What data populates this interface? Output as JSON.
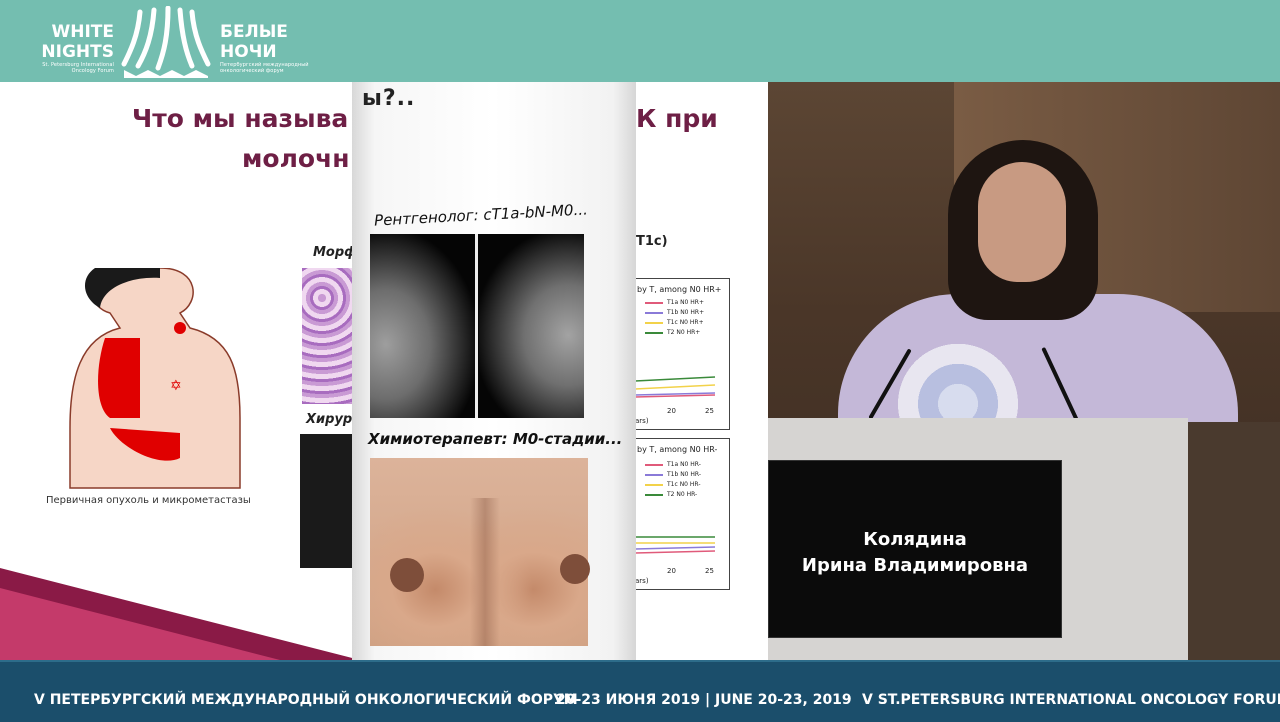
{
  "header": {
    "logo_en_line1": "WHITE",
    "logo_en_line2": "NIGHTS",
    "logo_en_sub": "St. Petersburg International Oncology Forum",
    "logo_ru_line1": "БЕЛЫЕ",
    "logo_ru_line2": "НОЧИ",
    "logo_ru_sub": "Петербургский международный онкологический форум",
    "colors": {
      "banner": "#74beb0",
      "logo": "#ffffff"
    }
  },
  "slide": {
    "title_line1": "Что мы называ",
    "title_line1_end": "К при",
    "title_line2": "молочн",
    "diagram_caption": "Первичная опухоль и микрометастазы",
    "morph_label": "Морф",
    "surg_label": "Хирург",
    "chart_section_label": "T1c)",
    "colors": {
      "title": "#6e1f45"
    }
  },
  "popup": {
    "header": "ы?..",
    "radiologist_label": "Рентгенолог: cT1a-bN-M0...",
    "chemo_label": "Химиотерапевт: M0-стадии..."
  },
  "charts": [
    {
      "title": "by T, among N0 HR+",
      "legend": [
        "T1a N0 HR+",
        "T1b N0 HR+",
        "T1c N0 HR+",
        "T2 N0 HR+"
      ],
      "colors": [
        "#e05a7a",
        "#8a7ad8",
        "#f2d24a",
        "#3a8a3a"
      ],
      "ticks": [
        "20",
        "25"
      ],
      "xlabel": "ars)"
    },
    {
      "title": "by T, among N0 HR-",
      "legend": [
        "T1a N0 HR-",
        "T1b N0 HR-",
        "T1c N0 HR-",
        "T2 N0 HR-"
      ],
      "colors": [
        "#e05a7a",
        "#8a7ad8",
        "#f2d24a",
        "#3a8a3a"
      ],
      "ticks": [
        "20",
        "25"
      ],
      "xlabel": "ars)"
    }
  ],
  "speaker": {
    "name_line1": "Колядина",
    "name_line2": "Ирина Владимировна"
  },
  "footer": {
    "left": "V ПЕТЕРБУРГСКИЙ МЕЖДУНАРОДНЫЙ ОНКОЛОГИЧЕСКИЙ ФОРУМ",
    "middle": "20-23 ИЮНЯ 2019 | JUNE 20-23, 2019",
    "right": "V ST.PETERSBURG INTERNATIONAL ONCOLOGY FORUM",
    "colors": {
      "bar": "#1b4e6b"
    }
  }
}
